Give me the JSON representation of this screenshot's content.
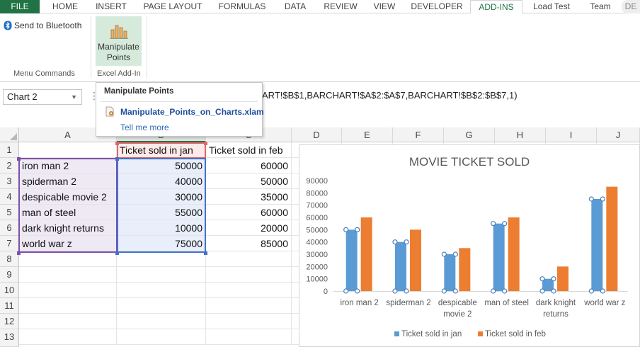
{
  "tabs": [
    "FILE",
    "HOME",
    "INSERT",
    "PAGE LAYOUT",
    "FORMULAS",
    "DATA",
    "REVIEW",
    "VIEW",
    "DEVELOPER",
    "ADD-INS",
    "Load Test",
    "Team",
    "DE"
  ],
  "ribbon": {
    "send_bluetooth": "Send to Bluetooth",
    "manipulate_line1": "Manipulate",
    "manipulate_line2": "Points",
    "group_menu": "Menu Commands",
    "group_addin": "Excel Add-In"
  },
  "namebox": {
    "value": "Chart 2"
  },
  "formula_bar": {
    "value": "ART!$B$1,BARCHART!$A$2:$A$7,BARCHART!$B$2:$B$7,1)"
  },
  "tooltip": {
    "title": "Manipulate Points",
    "file": "Manipulate_Points_on_Charts.xlam",
    "more": "Tell me more"
  },
  "columns": [
    "A",
    "B",
    "C",
    "D",
    "E",
    "F",
    "G",
    "H",
    "I",
    "J"
  ],
  "rows": [
    "1",
    "2",
    "3",
    "4",
    "5",
    "6",
    "7",
    "8",
    "9",
    "10",
    "11",
    "12",
    "13"
  ],
  "sheet": {
    "header_b": "Ticket sold in jan",
    "header_c": "Ticket sold in feb",
    "data": [
      {
        "a": "iron man 2",
        "b": "50000",
        "c": "60000"
      },
      {
        "a": "spiderman 2",
        "b": "40000",
        "c": "50000"
      },
      {
        "a": "despicable movie 2",
        "b": "30000",
        "c": "35000"
      },
      {
        "a": "man of steel",
        "b": "55000",
        "c": "60000"
      },
      {
        "a": "dark knight returns",
        "b": "10000",
        "c": "20000"
      },
      {
        "a": "world war z",
        "b": "75000",
        "c": "85000"
      }
    ]
  },
  "chart_data": {
    "type": "bar",
    "title": "MOVIE TICKET SOLD",
    "categories": [
      "iron man 2",
      "spiderman 2",
      "despicable movie 2",
      "man of steel",
      "dark knight returns",
      "world war z"
    ],
    "category_lines": [
      [
        "iron man 2"
      ],
      [
        "spiderman 2"
      ],
      [
        "despicable",
        "movie 2"
      ],
      [
        "man of steel"
      ],
      [
        "dark knight",
        "returns"
      ],
      [
        "world war z"
      ]
    ],
    "series": [
      {
        "name": "Ticket sold in jan",
        "values": [
          50000,
          40000,
          30000,
          55000,
          10000,
          75000
        ],
        "color": "#5b9bd5"
      },
      {
        "name": "Ticket sold in feb",
        "values": [
          60000,
          50000,
          35000,
          60000,
          20000,
          85000
        ],
        "color": "#ed7d31"
      }
    ],
    "yticks": [
      "0",
      "10000",
      "20000",
      "30000",
      "40000",
      "50000",
      "60000",
      "70000",
      "80000",
      "90000"
    ],
    "ylim": [
      0,
      90000
    ],
    "legend": "bottom",
    "selected_series": "Ticket sold in jan"
  }
}
